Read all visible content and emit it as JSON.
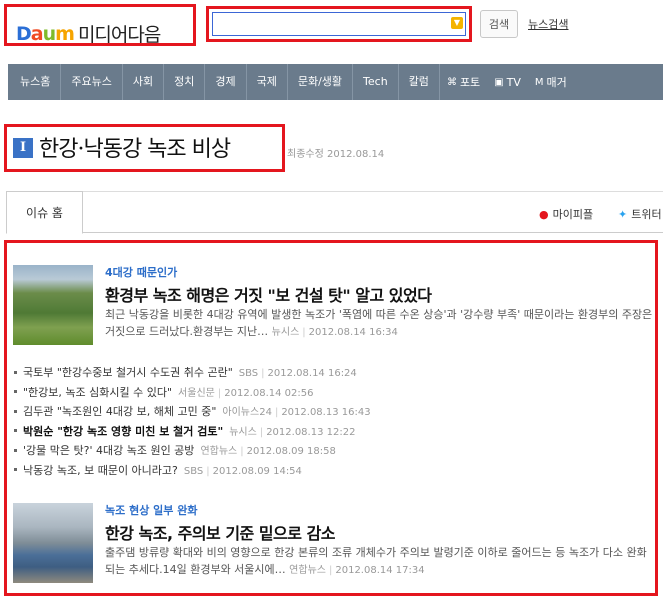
{
  "header": {
    "logo_daum": [
      "Da",
      "u",
      "m"
    ],
    "logo_daum_d": "D",
    "logo_media": "미디어다음",
    "search_placeholder": "",
    "search_button": "검색",
    "news_search": "뉴스검색"
  },
  "nav": {
    "items": [
      "뉴스홈",
      "주요뉴스",
      "사회",
      "정치",
      "경제",
      "국제",
      "문화/생활",
      "Tech",
      "칼럼"
    ],
    "sub": [
      {
        "icon": "photo-icon",
        "glyph": "⌘",
        "label": "포토"
      },
      {
        "icon": "tv-icon",
        "glyph": "▣",
        "label": "TV"
      },
      {
        "icon": "magazine-icon",
        "glyph": "M",
        "label": "매거"
      }
    ]
  },
  "issue": {
    "icon": "I",
    "title": "한강·낙동강 녹조 비상",
    "updated": "최종수정 2012.08.14"
  },
  "tabs": {
    "home": "이슈 홈",
    "share_mypeople": "마이피플",
    "share_twitter": "트위터"
  },
  "articles": [
    {
      "category": "4대강 때문인가",
      "headline": "환경부 녹조 해명은 거짓 \"보 건설 탓\" 알고 있었다",
      "summary": "최근 낙동강을 비롯한 4대강 유역에 발생한 녹조가 '폭염에 따른 수온 상승'과 '강수량 부족' 때문이라는 환경부의 주장은 거짓으로 드러났다.환경부는 지난…",
      "source": "뉴시스",
      "time": "2012.08.14 16:34"
    },
    {
      "category": "녹조 현상 일부 완화",
      "headline": "한강 녹조, 주의보 기준 밑으로 감소",
      "summary": "출주댐 방류량 확대와 비의 영향으로 한강 본류의 조류 개체수가 주의보 발령기준 이하로 줄어드는 등 녹조가 다소 완화되는 추세다.14일 환경부와 서울시에…",
      "source": "연합뉴스",
      "time": "2012.08.14 17:34"
    }
  ],
  "related": [
    {
      "title": "국토부 \"한강수중보 철거시 수도권 취수 곤란\"",
      "source": "SBS",
      "time": "2012.08.14 16:24",
      "bold": false
    },
    {
      "title": "\"한강보, 녹조 심화시킬 수 있다\"",
      "source": "서울신문",
      "time": "2012.08.14 02:56",
      "bold": false
    },
    {
      "title": "김두관 \"녹조원인 4대강 보, 해체 고민 중\"",
      "source": "아이뉴스24",
      "time": "2012.08.13 16:43",
      "bold": false
    },
    {
      "title": "박원순 \"한강 녹조 영향 미친 보 철거 검토\"",
      "source": "뉴시스",
      "time": "2012.08.13 12:22",
      "bold": true
    },
    {
      "title": "'강물 막은 탓?' 4대강 녹조 원인 공방",
      "source": "연합뉴스",
      "time": "2012.08.09 18:58",
      "bold": false
    },
    {
      "title": "낙동강 녹조, 보 때문이 아니라고?",
      "source": "SBS",
      "time": "2012.08.09 14:54",
      "bold": false
    }
  ],
  "colors": {
    "highlight_border": "#e4161e",
    "nav_bg": "#6a7b8c",
    "category": "#2d6ec9"
  }
}
